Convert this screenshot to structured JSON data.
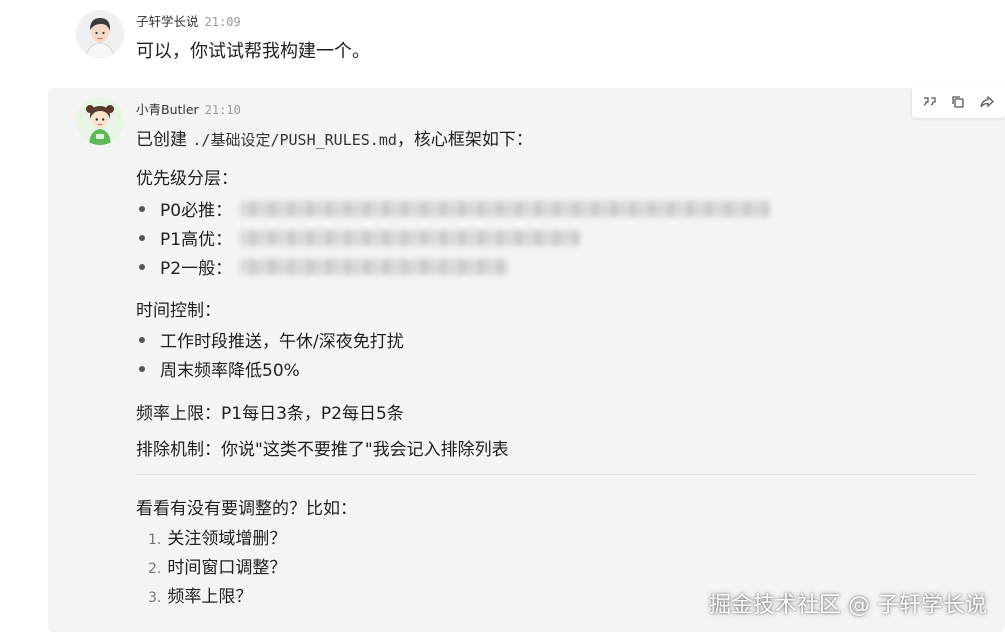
{
  "messages": [
    {
      "sender": "子轩学长说",
      "time": "21:09",
      "text": "可以，你试试帮我构建一个。"
    },
    {
      "sender": "小青Butler",
      "time": "21:10",
      "intro_prefix": "已创建 ",
      "intro_path": "./基础设定/PUSH_RULES.md",
      "intro_suffix": "，核心框架如下：",
      "priority_title": "优先级分层：",
      "priority_items": [
        {
          "label": "P0必推："
        },
        {
          "label": "P1高优："
        },
        {
          "label": "P2一般："
        }
      ],
      "time_title": "时间控制：",
      "time_items": [
        "工作时段推送，午休/深夜免打扰",
        "周末频率降低50%"
      ],
      "frequency_line": "频率上限：P1每日3条，P2每日5条",
      "exclusion_line": "排除机制：你说\"这类不要推了\"我会记入排除列表",
      "question": "看看有没有要调整的？比如：",
      "suggestions": [
        {
          "num": "1.",
          "text": "关注领域增删？"
        },
        {
          "num": "2.",
          "text": "时间窗口调整？"
        },
        {
          "num": "3.",
          "text": "频率上限？"
        }
      ]
    }
  ],
  "toolbar": {
    "icons": [
      "quote-icon",
      "copy-icon",
      "share-icon"
    ]
  },
  "watermark": "掘金技术社区 @ 子轩学长说"
}
